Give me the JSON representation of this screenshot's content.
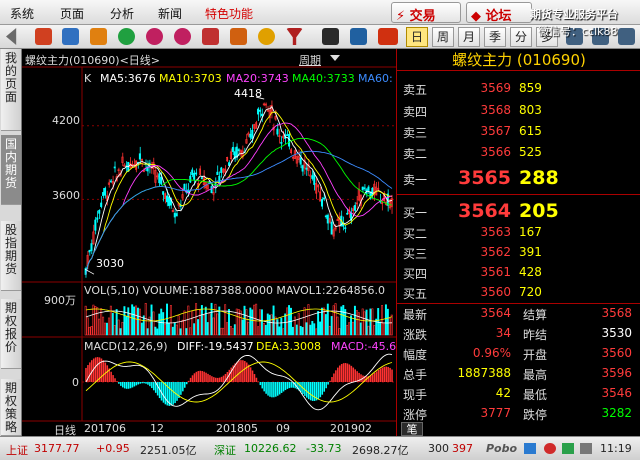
{
  "menu": {
    "items": [
      "系统",
      "页面",
      "分析",
      "新闻"
    ],
    "special": "特色功能",
    "trade": "⚡ 交易",
    "forum": "◆ 论坛",
    "promo_line1": "期货专业服务平台",
    "promo_line2": "微信号：cclk88"
  },
  "toolbar": {
    "period_buttons": [
      "日",
      "周",
      "月",
      "季",
      "分",
      "多"
    ]
  },
  "left_tabs": [
    "我的页面",
    "国内期货",
    "股指期货",
    "期权报价",
    "期权策略"
  ],
  "chart": {
    "title": "螺纹主力(010690)<日线>",
    "period_label": "周期",
    "marker": "K",
    "ma": [
      {
        "text": "MA5:3676",
        "color": "#ffffff"
      },
      {
        "text": "MA10:3703",
        "color": "#ffff00"
      },
      {
        "text": "MA20:3743",
        "color": "#ff40ff"
      },
      {
        "text": "MA40:3733",
        "color": "#00ff00"
      },
      {
        "text": "MA60:",
        "color": "#3c8cff"
      }
    ],
    "high_label": "4418",
    "low_label": "3030",
    "price_ticks": [
      "4200",
      "3600"
    ],
    "volume_tick": "900万",
    "volume_header": "VOL(5,10)  VOLUME:1887388.0000  MAVOL1:2264856.0",
    "macd_header_label": "MACD(12,26,9)",
    "macd_diff": "DIFF:-19.5437",
    "macd_dea": "DEA:3.3008",
    "macd_value": "MACD:-45.68",
    "macd_zero_tick": "0",
    "x_axis_title": "日线",
    "x_ticks": [
      "201706",
      "12",
      "201805",
      "09",
      "201902"
    ],
    "colors": {
      "up": "#ff3232",
      "down": "#00ffff",
      "grid": "#8b0000"
    }
  },
  "chart_data": {
    "type": "candlestick",
    "price_range": [
      2950,
      4500
    ],
    "high": 4418,
    "low": 3030,
    "price_ticks": [
      4200,
      3600
    ],
    "last_close": 3564,
    "volume_last": 1887388,
    "mavol1": 2264856,
    "macd": {
      "diff": -19.5437,
      "dea": 3.3008,
      "macd": -45.68
    },
    "ma_values": {
      "MA5": 3676,
      "MA10": 3703,
      "MA20": 3743,
      "MA40": 3733
    },
    "x_ticks": [
      "201706",
      "12",
      "201805",
      "09",
      "201902"
    ]
  },
  "quote": {
    "title": "螺纹主力 (010690)",
    "sells": [
      {
        "label": "卖五",
        "price": "3569",
        "vol": "859"
      },
      {
        "label": "卖四",
        "price": "3568",
        "vol": "803"
      },
      {
        "label": "卖三",
        "price": "3567",
        "vol": "615"
      },
      {
        "label": "卖二",
        "price": "3566",
        "vol": "525"
      },
      {
        "label": "卖一",
        "price": "3565",
        "vol": "288"
      }
    ],
    "buys": [
      {
        "label": "买一",
        "price": "3564",
        "vol": "205"
      },
      {
        "label": "买二",
        "price": "3563",
        "vol": "167"
      },
      {
        "label": "买三",
        "price": "3562",
        "vol": "391"
      },
      {
        "label": "买四",
        "price": "3561",
        "vol": "428"
      },
      {
        "label": "买五",
        "price": "3560",
        "vol": "720"
      }
    ],
    "stats": [
      {
        "l1": "最新",
        "v1": "3564",
        "c1": "#ff3b3b",
        "l2": "结算",
        "v2": "3568",
        "c2": "#ff3b3b"
      },
      {
        "l1": "涨跌",
        "v1": "34",
        "c1": "#ff3b3b",
        "l2": "昨结",
        "v2": "3530",
        "c2": "#ffffff"
      },
      {
        "l1": "幅度",
        "v1": "0.96%",
        "c1": "#ff3b3b",
        "l2": "开盘",
        "v2": "3560",
        "c2": "#ff3b3b"
      },
      {
        "l1": "总手",
        "v1": "1887388",
        "c1": "#ffff00",
        "l2": "最高",
        "v2": "3596",
        "c2": "#ff3b3b"
      },
      {
        "l1": "现手",
        "v1": "42",
        "c1": "#ffff00",
        "l2": "最低",
        "v2": "3546",
        "c2": "#ff3b3b"
      },
      {
        "l1": "涨停",
        "v1": "3777",
        "c1": "#ff3b3b",
        "l2": "跌停",
        "v2": "3282",
        "c2": "#00ff00"
      }
    ],
    "bottom_tab": "笔"
  },
  "status": {
    "items": [
      {
        "text": "上证",
        "color": "#c00000"
      },
      {
        "text": "3177.77",
        "color": "#c00000"
      },
      {
        "text": "+0.95",
        "color": "#c00000"
      },
      {
        "text": "2251.05亿",
        "color": "#222222"
      },
      {
        "text": "深证",
        "color": "#008000"
      },
      {
        "text": "10226.62",
        "color": "#008000"
      },
      {
        "text": "-33.73",
        "color": "#008000"
      },
      {
        "text": "2698.27亿",
        "color": "#222222"
      },
      {
        "text": "300",
        "color": "#222222"
      },
      {
        "text": "397",
        "color": "#c00000"
      },
      {
        "text": "Pobo",
        "color": "#555555"
      },
      {
        "text": "11:19",
        "color": "#222222"
      }
    ]
  }
}
